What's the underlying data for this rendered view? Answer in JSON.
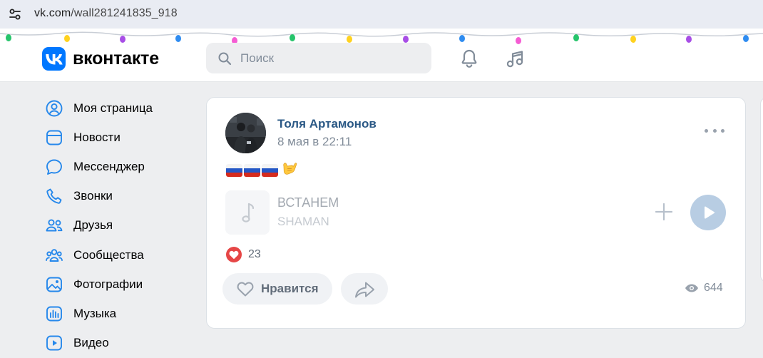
{
  "browser": {
    "url_host": "vk.com",
    "url_path": "/wall281241835_918"
  },
  "header": {
    "logo_text": "вконтакте",
    "search_placeholder": "Поиск",
    "brand_color": "#0077ff"
  },
  "sidebar": {
    "items": [
      {
        "label": "Моя страница",
        "icon": "user-circle-icon"
      },
      {
        "label": "Новости",
        "icon": "newsfeed-icon"
      },
      {
        "label": "Мессенджер",
        "icon": "message-icon"
      },
      {
        "label": "Звонки",
        "icon": "phone-icon"
      },
      {
        "label": "Друзья",
        "icon": "friends-icon"
      },
      {
        "label": "Сообщества",
        "icon": "communities-icon"
      },
      {
        "label": "Фотографии",
        "icon": "photos-icon"
      },
      {
        "label": "Музыка",
        "icon": "music-icon"
      },
      {
        "label": "Видео",
        "icon": "video-icon"
      }
    ]
  },
  "post": {
    "author": "Толя Артамонов",
    "date": "8 мая в 22:11",
    "text_emoji": "🤙",
    "flag_count": 3,
    "track": {
      "title": "ВСТАНЕМ",
      "artist": "SHAMAN"
    },
    "likes_count": "23",
    "like_label": "Нравится",
    "views_count": "644"
  }
}
